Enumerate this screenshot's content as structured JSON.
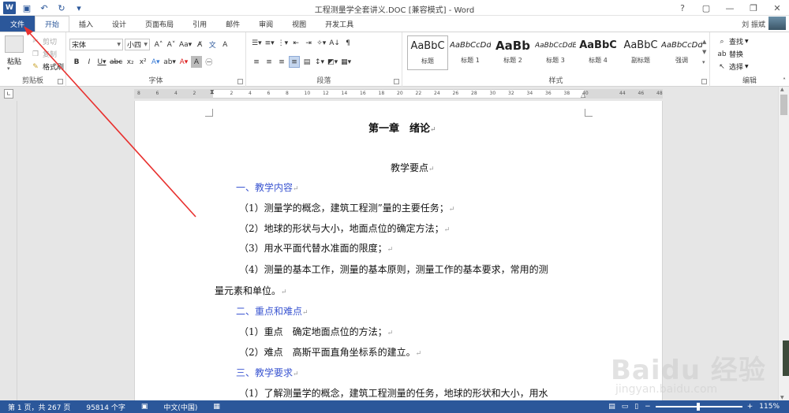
{
  "title": "工程测量学全套讲义.DOC [兼容模式] - Word",
  "window": {
    "help": "?",
    "min": "—",
    "restore": "❐",
    "close": "✕"
  },
  "tabs": [
    "文件",
    "开始",
    "插入",
    "设计",
    "页面布局",
    "引用",
    "邮件",
    "审阅",
    "视图",
    "开发工具"
  ],
  "user": "刘 振斌",
  "clipboard": {
    "paste": "粘贴",
    "cut": "剪切",
    "copy": "复制",
    "painter": "格式刷",
    "label": "剪贴板"
  },
  "font": {
    "name": "宋体",
    "size": "小四",
    "label": "字体"
  },
  "paragraph": {
    "label": "段落"
  },
  "styles": {
    "label": "样式",
    "items": [
      {
        "preview": "AaBbC",
        "name": "标题"
      },
      {
        "preview": "AaBbCcDd",
        "name": "标题 1"
      },
      {
        "preview": "AaBb",
        "name": "标题 2"
      },
      {
        "preview": "AaBbCcDdE",
        "name": "标题 3"
      },
      {
        "preview": "AaBbC",
        "name": "标题 4"
      },
      {
        "preview": "AaBbC",
        "name": "副标题"
      },
      {
        "preview": "AaBbCcDd",
        "name": "强调"
      }
    ]
  },
  "editing": {
    "find": "查找",
    "replace": "替换",
    "select": "选择",
    "label": "编辑"
  },
  "ruler": {
    "ticks": [
      "8",
      "6",
      "4",
      "2",
      "",
      "2",
      "4",
      "6",
      "8",
      "10",
      "12",
      "14",
      "16",
      "18",
      "20",
      "22",
      "24",
      "26",
      "28",
      "30",
      "32",
      "34",
      "36",
      "38",
      "40",
      "",
      "44",
      "46",
      "48"
    ]
  },
  "document": {
    "chapter": "第一章　绪论",
    "subtitle": "教学要点",
    "h1": "一、教学内容",
    "p1": "（1）测量学的概念，建筑工程测”量的主要任务；",
    "p2": "（2）地球的形状与大小，地面点位的确定方法；",
    "p3": "（3）用水平面代替水准面的限度；",
    "p4a": "（4）测量的基本工作，测量的基本原则，测量工作的基本要求，常用的测",
    "p4b": "量元素和单位。",
    "h2": "二、重点和难点",
    "p5": "（1）重点　确定地面点位的方法；",
    "p6": "（2）难点　高斯平面直角坐标系的建立。",
    "h3": "三、教学要求",
    "p7": "（1）了解测量学的概念，建筑工程测量的任务，地球的形状和大小，用水"
  },
  "status": {
    "page": "第 1 页，共 267 页",
    "words": "95814 个字",
    "lang": "中文(中国)",
    "zoom": "115%"
  },
  "watermark": {
    "brand": "Baidu 经验",
    "url": "jingyan.baidu.com"
  },
  "colors": {
    "accent": "#2b579a",
    "heading": "#3a55d1",
    "arrow": "#e8312f"
  }
}
